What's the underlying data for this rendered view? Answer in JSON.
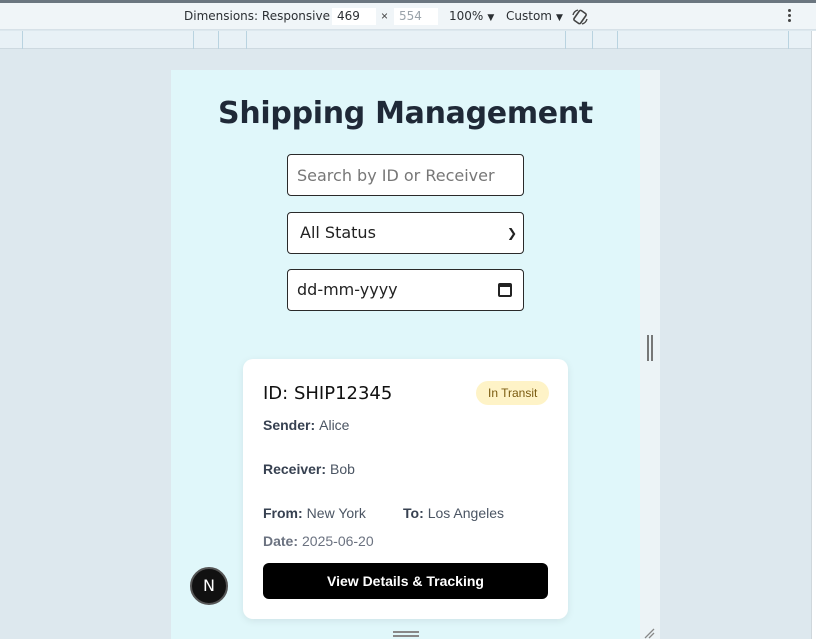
{
  "devtools": {
    "dimensions_label": "Dimensions: Responsive",
    "width": "469",
    "height": "554",
    "zoom": "100%",
    "throttle": "Custom",
    "rotate_icon": "rotate-icon",
    "more_icon": "more-vert-icon"
  },
  "page": {
    "title": "Shipping Management",
    "search_placeholder": "Search by ID or Receiver",
    "status_selected": "All Status",
    "date_placeholder": "dd-mm-yyyy"
  },
  "shipment": {
    "id_label": "ID: SHIP12345",
    "status": "In Transit",
    "sender_label": "Sender:",
    "sender": "Alice",
    "receiver_label": "Receiver:",
    "receiver": "Bob",
    "from_label": "From:",
    "from": "New York",
    "to_label": "To:",
    "to": "Los Angeles",
    "date_label": "Date:",
    "date": "2025-06-20",
    "button_label": "View Details & Tracking"
  },
  "overlay": {
    "next_badge_letter": "N"
  },
  "colors": {
    "page_bg": "#e0f7fa",
    "badge_bg": "#fef3c7",
    "button_bg": "#000000"
  }
}
